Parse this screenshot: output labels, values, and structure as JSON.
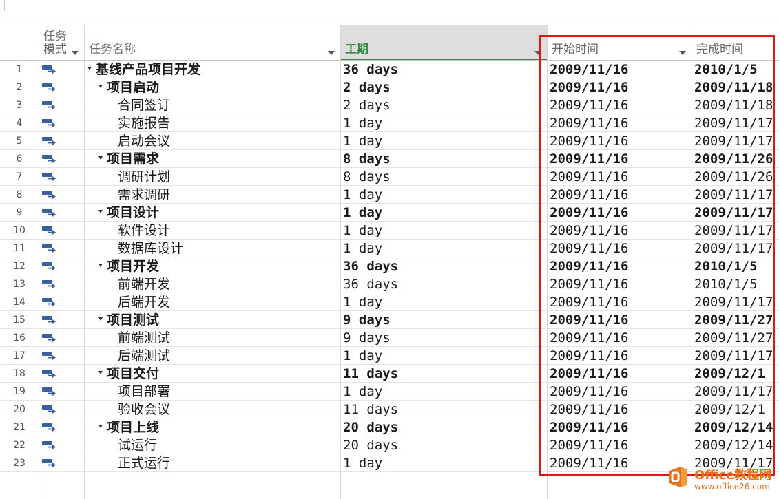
{
  "header": {
    "mode_label_line1": "任务",
    "mode_label_line2": "模式",
    "name_label": "任务名称",
    "duration_label": "工期",
    "start_label": "开始时间",
    "finish_label": "完成时间"
  },
  "rows": [
    {
      "id": "1",
      "name": "基线产品项目开发",
      "duration": "36 days",
      "start": "2009/11/16",
      "finish": "2010/1/5",
      "summary": true,
      "level": 0
    },
    {
      "id": "2",
      "name": "项目启动",
      "duration": "2 days",
      "start": "2009/11/16",
      "finish": "2009/11/18",
      "summary": true,
      "level": 1
    },
    {
      "id": "3",
      "name": "合同签订",
      "duration": "2 days",
      "start": "2009/11/16",
      "finish": "2009/11/18",
      "summary": false,
      "level": 2
    },
    {
      "id": "4",
      "name": "实施报告",
      "duration": "1 day",
      "start": "2009/11/16",
      "finish": "2009/11/17",
      "summary": false,
      "level": 2
    },
    {
      "id": "5",
      "name": "启动会议",
      "duration": "1 day",
      "start": "2009/11/16",
      "finish": "2009/11/17",
      "summary": false,
      "level": 2
    },
    {
      "id": "6",
      "name": "项目需求",
      "duration": "8 days",
      "start": "2009/11/16",
      "finish": "2009/11/26",
      "summary": true,
      "level": 1
    },
    {
      "id": "7",
      "name": "调研计划",
      "duration": "8 days",
      "start": "2009/11/16",
      "finish": "2009/11/26",
      "summary": false,
      "level": 2
    },
    {
      "id": "8",
      "name": "需求调研",
      "duration": "1 day",
      "start": "2009/11/16",
      "finish": "2009/11/17",
      "summary": false,
      "level": 2
    },
    {
      "id": "9",
      "name": "项目设计",
      "duration": "1 day",
      "start": "2009/11/16",
      "finish": "2009/11/17",
      "summary": true,
      "level": 1
    },
    {
      "id": "10",
      "name": "软件设计",
      "duration": "1 day",
      "start": "2009/11/16",
      "finish": "2009/11/17",
      "summary": false,
      "level": 2
    },
    {
      "id": "11",
      "name": "数据库设计",
      "duration": "1 day",
      "start": "2009/11/16",
      "finish": "2009/11/17",
      "summary": false,
      "level": 2
    },
    {
      "id": "12",
      "name": "项目开发",
      "duration": "36 days",
      "start": "2009/11/16",
      "finish": "2010/1/5",
      "summary": true,
      "level": 1
    },
    {
      "id": "13",
      "name": "前端开发",
      "duration": "36 days",
      "start": "2009/11/16",
      "finish": "2010/1/5",
      "summary": false,
      "level": 2
    },
    {
      "id": "14",
      "name": "后端开发",
      "duration": "1 day",
      "start": "2009/11/16",
      "finish": "2009/11/17",
      "summary": false,
      "level": 2
    },
    {
      "id": "15",
      "name": "项目测试",
      "duration": "9 days",
      "start": "2009/11/16",
      "finish": "2009/11/27",
      "summary": true,
      "level": 1
    },
    {
      "id": "16",
      "name": "前端测试",
      "duration": "9 days",
      "start": "2009/11/16",
      "finish": "2009/11/27",
      "summary": false,
      "level": 2
    },
    {
      "id": "17",
      "name": "后端测试",
      "duration": "1 day",
      "start": "2009/11/16",
      "finish": "2009/11/17",
      "summary": false,
      "level": 2
    },
    {
      "id": "18",
      "name": "项目交付",
      "duration": "11 days",
      "start": "2009/11/16",
      "finish": "2009/12/1",
      "summary": true,
      "level": 1
    },
    {
      "id": "19",
      "name": "项目部署",
      "duration": "1 day",
      "start": "2009/11/16",
      "finish": "2009/11/17",
      "summary": false,
      "level": 2
    },
    {
      "id": "20",
      "name": "验收会议",
      "duration": "11 days",
      "start": "2009/11/16",
      "finish": "2009/12/1",
      "summary": false,
      "level": 2
    },
    {
      "id": "21",
      "name": "项目上线",
      "duration": "20 days",
      "start": "2009/11/16",
      "finish": "2009/12/14",
      "summary": true,
      "level": 1
    },
    {
      "id": "22",
      "name": "试运行",
      "duration": "20 days",
      "start": "2009/11/16",
      "finish": "2009/12/14",
      "summary": false,
      "level": 2
    },
    {
      "id": "23",
      "name": "正式运行",
      "duration": "1 day",
      "start": "2009/11/16",
      "finish": "2009/11/17",
      "summary": false,
      "level": 2
    }
  ],
  "icons": {
    "task_mode": "auto-schedule-task-icon",
    "collapse": "collapse-triangle-icon",
    "dropdown": "dropdown-arrow-icon"
  },
  "colors": {
    "highlight_border": "#e01717",
    "duration_header_text": "#2e8b3d",
    "watermark": "#e8711a",
    "task_icon": "#3a5f9e"
  },
  "watermark": {
    "title": "Office教程网",
    "url": "www.office26.com"
  }
}
